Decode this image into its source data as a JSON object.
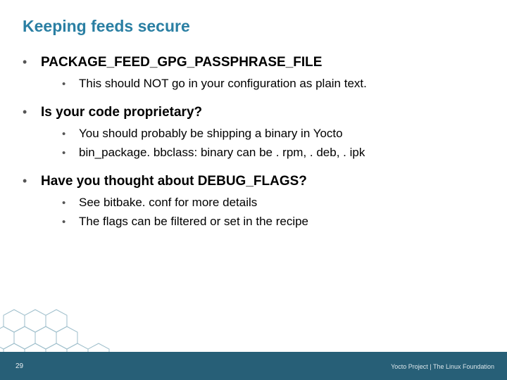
{
  "title": "Keeping feeds secure",
  "bullets": [
    {
      "text": "PACKAGE_FEED_GPG_PASSPHRASE_FILE",
      "sub": [
        "This should NOT go in your configuration as plain text."
      ]
    },
    {
      "text": "Is your code proprietary?",
      "sub": [
        "You should probably be shipping a binary in Yocto",
        "bin_package. bbclass: binary can be . rpm, . deb, . ipk"
      ]
    },
    {
      "text": "Have you thought about DEBUG_FLAGS?",
      "sub": [
        "See bitbake. conf for more details",
        "The flags can be filtered or set in the recipe"
      ]
    }
  ],
  "page_number": "29",
  "footer": "Yocto Project | The Linux Foundation"
}
